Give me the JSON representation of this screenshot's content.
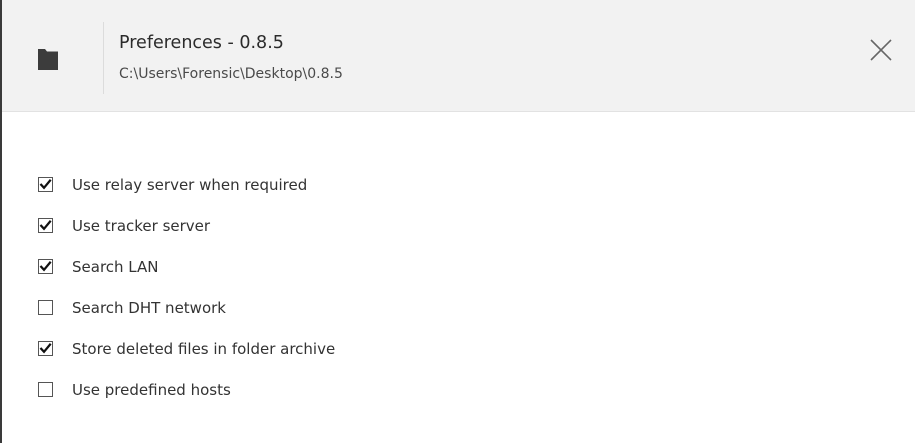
{
  "dialog": {
    "title": "Preferences - 0.8.5",
    "path": "C:\\Users\\Forensic\\Desktop\\0.8.5",
    "icon": "folder-icon",
    "close_icon": "close-icon"
  },
  "options": [
    {
      "label": "Use relay server when required",
      "checked": true
    },
    {
      "label": "Use tracker server",
      "checked": true
    },
    {
      "label": "Search LAN",
      "checked": true
    },
    {
      "label": "Search DHT network",
      "checked": false
    },
    {
      "label": "Store deleted files in folder archive",
      "checked": true
    },
    {
      "label": "Use predefined hosts",
      "checked": false
    }
  ],
  "colors": {
    "header_bg": "#f2f2f2",
    "text": "#333333",
    "icon": "#3c3c3c"
  }
}
